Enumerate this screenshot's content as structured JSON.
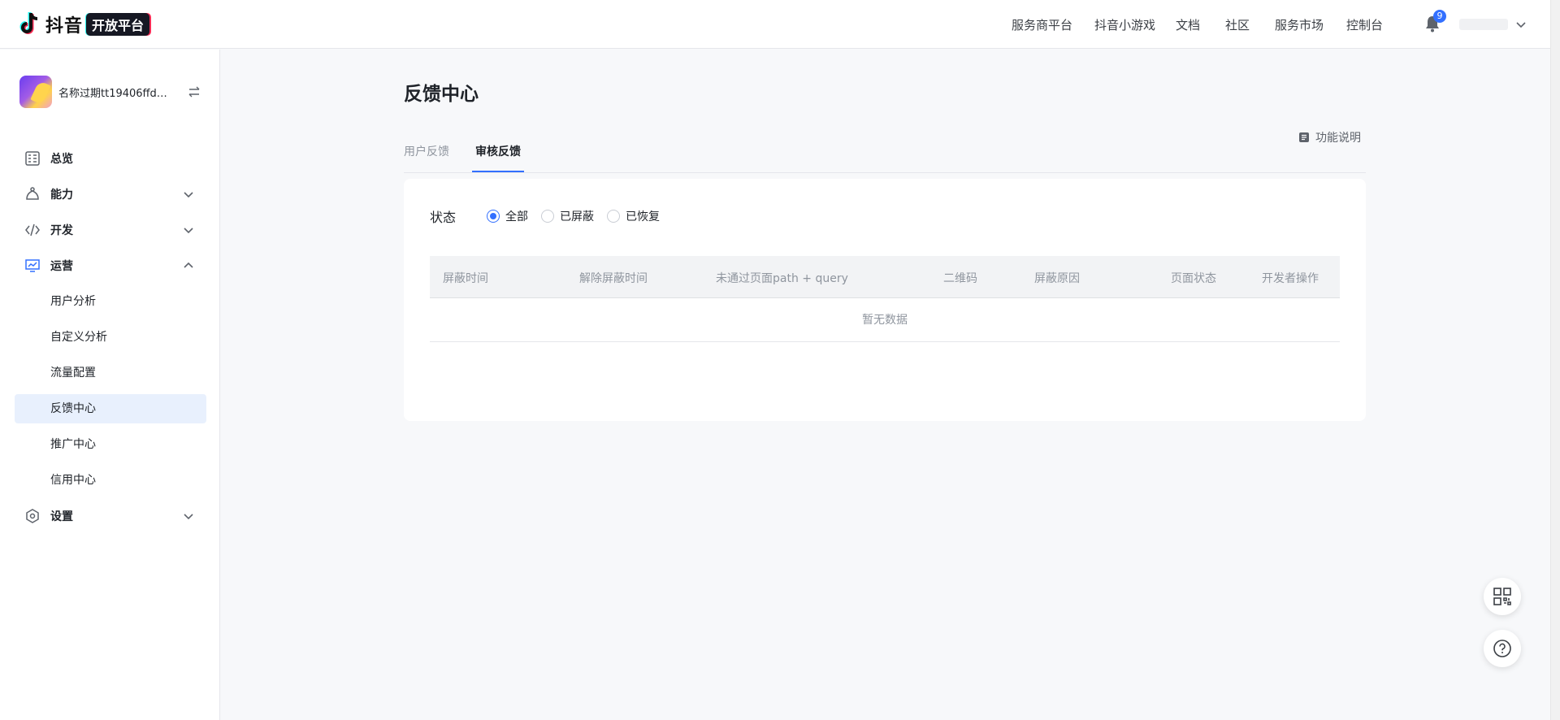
{
  "brand": {
    "name": "抖音",
    "badge": "开放平台"
  },
  "top_nav": [
    "服务商平台",
    "抖音小游戏",
    "文档",
    "社区",
    "服务市场",
    "控制台"
  ],
  "notifications": {
    "count": "9"
  },
  "app": {
    "name": "名称过期tt19406ffd86..."
  },
  "sidebar": {
    "menu": [
      {
        "label": "总览",
        "icon": "dashboard-icon"
      },
      {
        "label": "能力",
        "icon": "capability-icon"
      },
      {
        "label": "开发",
        "icon": "code-icon"
      },
      {
        "label": "运营",
        "icon": "operations-chart-icon"
      },
      {
        "label": "设置",
        "icon": "settings-icon"
      }
    ],
    "operations_sub": [
      "用户分析",
      "自定义分析",
      "流量配置",
      "反馈中心",
      "推广中心",
      "信用中心"
    ],
    "active_sub": "反馈中心"
  },
  "page": {
    "title": "反馈中心",
    "tabs": [
      "用户反馈",
      "审核反馈"
    ],
    "active_tab": "审核反馈",
    "help_link": "功能说明"
  },
  "filter": {
    "label": "状态",
    "options": [
      "全部",
      "已屏蔽",
      "已恢复"
    ],
    "selected": "全部"
  },
  "table": {
    "columns": [
      "屏蔽时间",
      "解除屏蔽时间",
      "未通过页面path + query",
      "二维码",
      "屏蔽原因",
      "页面状态",
      "开发者操作"
    ],
    "empty_text": "暂无数据"
  },
  "colors": {
    "accent": "#3370ff",
    "active_bg": "#e8f0fd"
  }
}
